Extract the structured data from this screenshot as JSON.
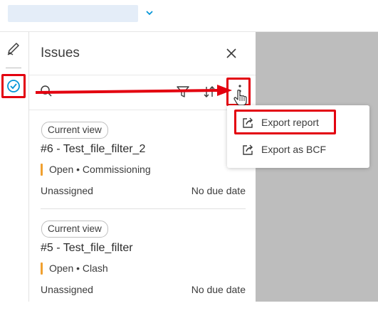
{
  "colors": {
    "accent": "#0696d7",
    "highlight": "#e3000f",
    "status": "#f0a030",
    "viewer_bg": "#bdbdbd"
  },
  "topbar": {
    "dropdown_icon": "chevron-down-icon"
  },
  "rail": {
    "tools": [
      "markup-pen-icon",
      "issues-check-icon"
    ]
  },
  "panel": {
    "title": "Issues",
    "toolbar_icons": [
      "search-icon",
      "filter-icon",
      "sort-icon",
      "more-vertical-icon"
    ]
  },
  "issues": [
    {
      "tag": "Current view",
      "title": "#6 - Test_file_filter_2",
      "status": "Open • Commissioning",
      "assignee": "Unassigned",
      "due": "No due date"
    },
    {
      "tag": "Current view",
      "title": "#5 - Test_file_filter",
      "status": "Open • Clash",
      "assignee": "Unassigned",
      "due": "No due date"
    }
  ],
  "menu": {
    "items": [
      {
        "label": "Export report",
        "icon": "export-icon"
      },
      {
        "label": "Export as BCF",
        "icon": "export-icon"
      }
    ]
  }
}
